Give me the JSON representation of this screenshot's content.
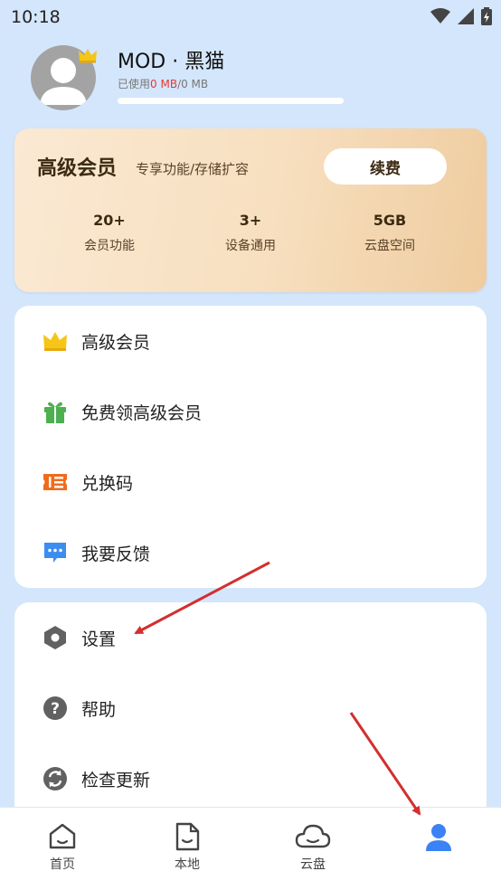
{
  "status_bar": {
    "time": "10:18"
  },
  "profile": {
    "name": "MOD · 黑猫",
    "storage_prefix": "已使用",
    "storage_used": "0 MB",
    "storage_total": "/0 MB"
  },
  "vip_card": {
    "title": "高级会员",
    "subtitle": "专享功能/存储扩容",
    "renew_label": "续费",
    "stats": [
      {
        "value": "20+",
        "label": "会员功能"
      },
      {
        "value": "3+",
        "label": "设备通用"
      },
      {
        "value": "5GB",
        "label": "云盘空间"
      }
    ]
  },
  "menu_group_1": [
    {
      "label": "高级会员",
      "icon": "crown-icon"
    },
    {
      "label": "免费领高级会员",
      "icon": "gift-icon"
    },
    {
      "label": "兑换码",
      "icon": "ticket-icon"
    },
    {
      "label": "我要反馈",
      "icon": "feedback-icon"
    }
  ],
  "menu_group_2": [
    {
      "label": "设置",
      "icon": "settings-icon"
    },
    {
      "label": "帮助",
      "icon": "help-icon"
    },
    {
      "label": "检查更新",
      "icon": "refresh-icon"
    }
  ],
  "bottom_nav": [
    {
      "label": "首页",
      "icon": "home-icon"
    },
    {
      "label": "本地",
      "icon": "local-file-icon"
    },
    {
      "label": "云盘",
      "icon": "cloud-icon"
    },
    {
      "label": "",
      "icon": "profile-icon",
      "active": true
    }
  ],
  "colors": {
    "background": "#d4e6fb",
    "accent": "#3b82f6",
    "storage_used": "#e53935",
    "vip_text": "#3d2a12",
    "arrow": "#d32f2f"
  }
}
